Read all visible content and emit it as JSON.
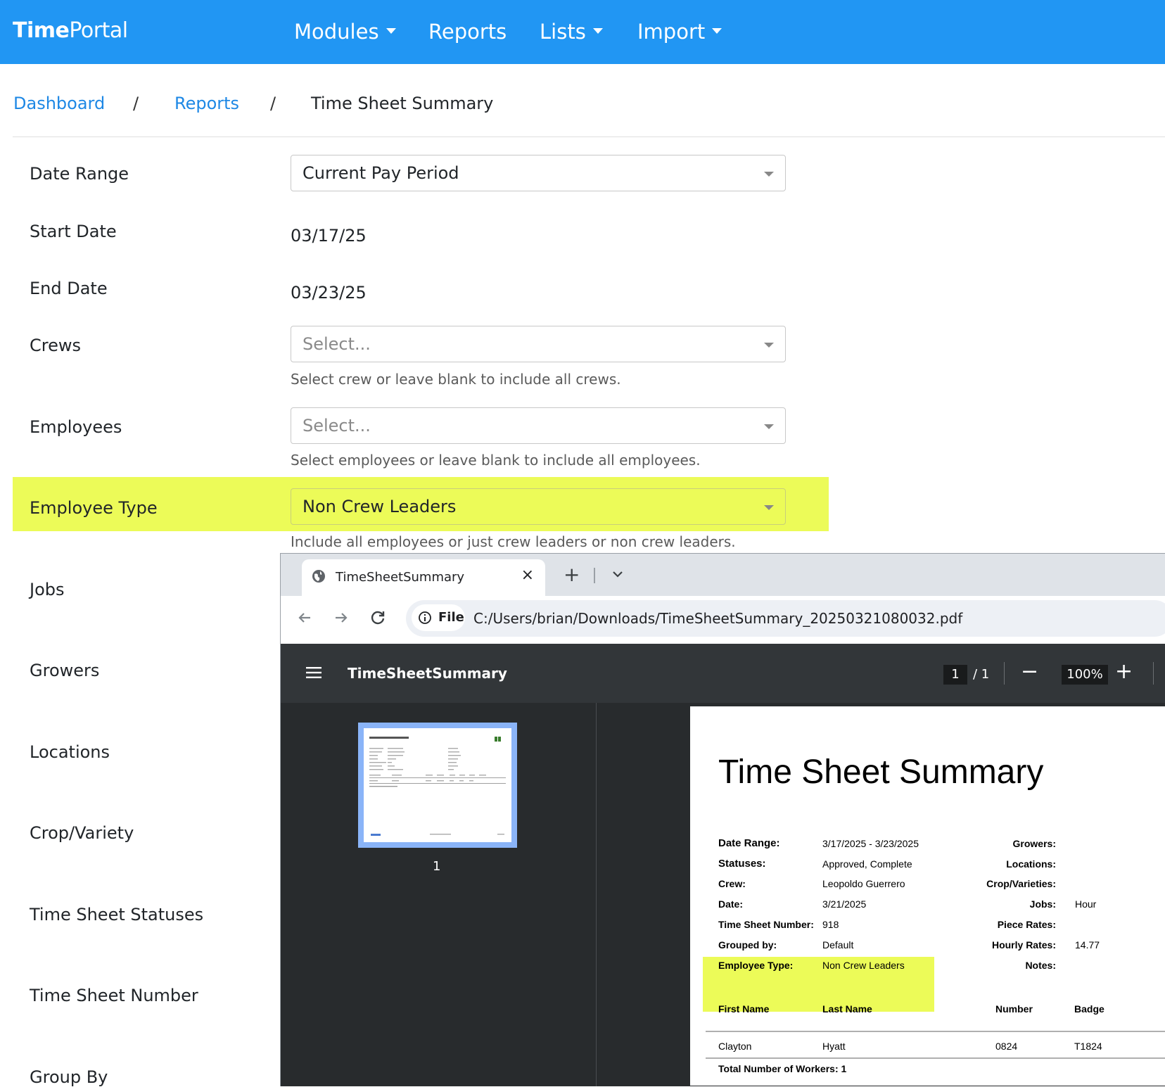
{
  "nav": {
    "brand_bold": "Time",
    "brand_rest": "Portal",
    "items": [
      {
        "label": "Modules"
      },
      {
        "label": "Reports"
      },
      {
        "label": "Lists"
      },
      {
        "label": "Import"
      }
    ]
  },
  "breadcrumb": {
    "home": "Dashboard",
    "sep": "/",
    "parent": "Reports",
    "current": "Time Sheet Summary"
  },
  "form": {
    "date_range": {
      "label": "Date Range",
      "value": "Current Pay Period"
    },
    "start_date": {
      "label": "Start Date",
      "value": "03/17/25"
    },
    "end_date": {
      "label": "End Date",
      "value": "03/23/25"
    },
    "crews": {
      "label": "Crews",
      "placeholder": "Select...",
      "help": "Select crew or leave blank to include all crews."
    },
    "employees": {
      "label": "Employees",
      "placeholder": "Select...",
      "help": "Select employees or leave blank to include all employees."
    },
    "employee_type": {
      "label": "Employee Type",
      "value": "Non Crew Leaders",
      "help": "Include all employees or just crew leaders or non crew leaders."
    },
    "jobs": {
      "label": "Jobs"
    },
    "growers": {
      "label": "Growers"
    },
    "locations": {
      "label": "Locations"
    },
    "crop_variety": {
      "label": "Crop/Variety"
    },
    "statuses": {
      "label": "Time Sheet Statuses"
    },
    "ts_number": {
      "label": "Time Sheet Number"
    },
    "group_by": {
      "label": "Group By"
    }
  },
  "browser": {
    "tab_title": "TimeSheetSummary",
    "tab_close": "×",
    "new_tab": "+",
    "chip_label": "File",
    "url": "C:/Users/brian/Downloads/TimeSheetSummary_20250321080032.pdf"
  },
  "pdf_viewer": {
    "title": "TimeSheetSummary",
    "page_current": "1",
    "page_total": "/  1",
    "zoom_out": "−",
    "zoom": "100%",
    "zoom_in": "+",
    "thumb_number": "1"
  },
  "report": {
    "title": "Time Sheet Summary",
    "left_fields": [
      {
        "label": "Date Range:",
        "value": "3/17/2025 - 3/23/2025"
      },
      {
        "label": "Statuses:",
        "value": "Approved, Complete"
      },
      {
        "label": "Crew:",
        "value": "Leopoldo Guerrero"
      },
      {
        "label": "Date:",
        "value": "3/21/2025"
      },
      {
        "label": "Time Sheet Number:",
        "value": "918"
      },
      {
        "label": "Grouped by:",
        "value": "Default"
      },
      {
        "label": "Employee Type:",
        "value": "Non Crew Leaders"
      }
    ],
    "right_fields": [
      {
        "label": "Growers:",
        "value": ""
      },
      {
        "label": "Locations:",
        "value": ""
      },
      {
        "label": "Crop/Varieties:",
        "value": ""
      },
      {
        "label": "Jobs:",
        "value": "Hour"
      },
      {
        "label": "Piece Rates:",
        "value": ""
      },
      {
        "label": "Hourly Rates:",
        "value": "14.77"
      },
      {
        "label": "Notes:",
        "value": ""
      }
    ],
    "columns": [
      "First Name",
      "Last Name",
      "Number",
      "Badge"
    ],
    "rows": [
      [
        "Clayton",
        "Hyatt",
        "0824",
        "T1824"
      ]
    ],
    "total_label": "Total Number of Workers: 1"
  },
  "colors": {
    "nav_blue": "#2196f3",
    "link_blue": "#1e88e5",
    "highlight": "#ecfb58",
    "pdf_toolbar": "#323639",
    "pdf_bg": "#282b2d"
  }
}
